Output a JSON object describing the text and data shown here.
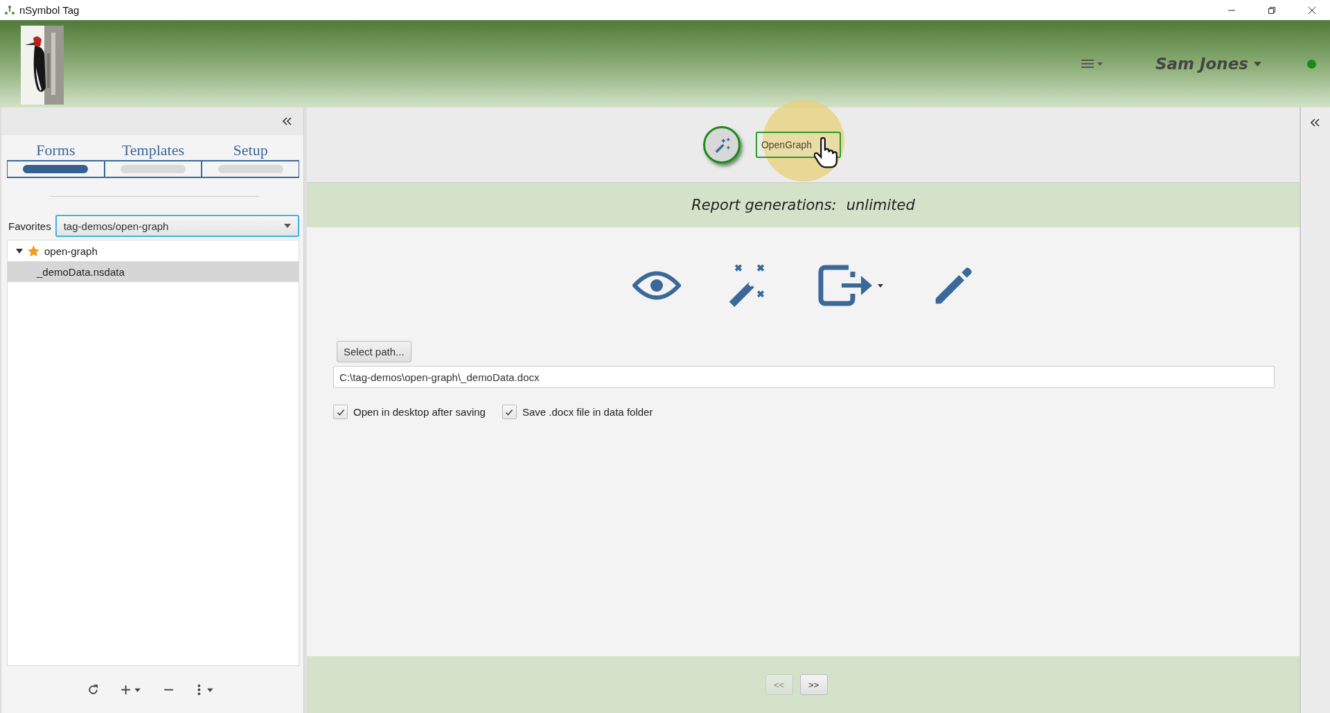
{
  "window": {
    "title": "nSymbol Tag"
  },
  "header": {
    "user": "Sam Jones"
  },
  "left_panel": {
    "tabs": [
      {
        "label": "Forms",
        "selected": true
      },
      {
        "label": "Templates",
        "selected": false
      },
      {
        "label": "Setup",
        "selected": false
      }
    ],
    "favorites": {
      "label": "Favorites",
      "value": "tag-demos/open-graph"
    },
    "tree": [
      {
        "label": "open-graph",
        "starred": true,
        "expanded": true,
        "selected": false,
        "children": [
          {
            "label": "_demoData.nsdata",
            "selected": true
          }
        ]
      }
    ]
  },
  "toolbar": {
    "button": "OpenGraph"
  },
  "banner": {
    "label": "Report generations:",
    "value": "unlimited"
  },
  "output": {
    "button": "Select path...",
    "path": "C:\\tag-demos\\open-graph\\_demoData.docx",
    "options": [
      {
        "label": "Open in desktop after saving",
        "checked": true
      },
      {
        "label": "Save .docx file in data folder",
        "checked": true
      }
    ]
  },
  "pager": [
    {
      "label": "<<",
      "disabled": true
    },
    {
      "label": ">>",
      "disabled": false
    }
  ]
}
